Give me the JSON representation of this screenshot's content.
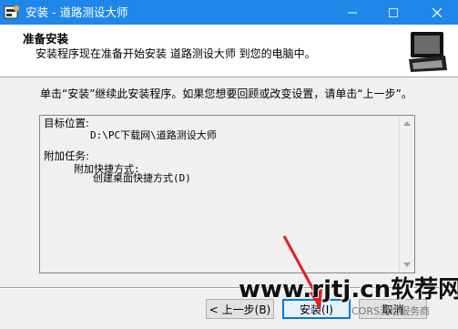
{
  "window": {
    "title": "安装 - 道路测设大师",
    "minimize_icon": "minimize-icon",
    "maximize_icon": "maximize-icon",
    "close_icon": "close-icon"
  },
  "header": {
    "title": "准备安装",
    "description": "安装程序现在准备开始安装 道路测设大师 到您的电脑中。"
  },
  "body": {
    "instruction": "单击“安装”继续此安装程序。如果您想要回顾或改变设置，请单击“上一步”。",
    "memo": {
      "dest_label": "目标位置:",
      "dest_value": "D:\\PC下载网\\道路测设大师",
      "tasks_label": "附加任务:",
      "task_group": "附加快捷方式:",
      "task_item": "创建桌面快捷方式(D)"
    }
  },
  "buttons": {
    "back": "< 上一步(B)",
    "install": "安装(I)",
    "cancel": "取消"
  },
  "overlay": {
    "watermark": "www.rjtj.cn软荐网",
    "wechat": "CORS测绘服务商"
  },
  "colors": {
    "titlebar": "#1f87ea",
    "arrow": "#e02020"
  }
}
